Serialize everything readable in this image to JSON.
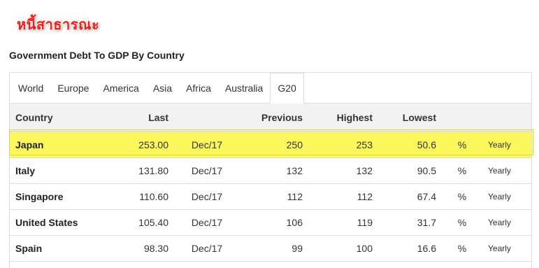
{
  "badge": "หนี้สาธารณะ",
  "title": "Government Debt To GDP By Country",
  "tabs": [
    {
      "label": "World"
    },
    {
      "label": "Europe"
    },
    {
      "label": "America"
    },
    {
      "label": "Asia"
    },
    {
      "label": "Africa"
    },
    {
      "label": "Australia"
    },
    {
      "label": "G20",
      "active": true
    }
  ],
  "table": {
    "headers": {
      "country": "Country",
      "last": "Last",
      "previous": "Previous",
      "highest": "Highest",
      "lowest": "Lowest"
    },
    "rows": [
      {
        "country": "Japan",
        "last": "253.00",
        "date": "Dec/17",
        "previous": "250",
        "highest": "253",
        "lowest": "50.6",
        "unit": "%",
        "frequency": "Yearly",
        "highlighted": true
      },
      {
        "country": "Italy",
        "last": "131.80",
        "date": "Dec/17",
        "previous": "132",
        "highest": "132",
        "lowest": "90.5",
        "unit": "%",
        "frequency": "Yearly"
      },
      {
        "country": "Singapore",
        "last": "110.60",
        "date": "Dec/17",
        "previous": "112",
        "highest": "112",
        "lowest": "67.4",
        "unit": "%",
        "frequency": "Yearly"
      },
      {
        "country": "United States",
        "last": "105.40",
        "date": "Dec/17",
        "previous": "106",
        "highest": "119",
        "lowest": "31.7",
        "unit": "%",
        "frequency": "Yearly"
      },
      {
        "country": "Spain",
        "last": "98.30",
        "date": "Dec/17",
        "previous": "99",
        "highest": "100",
        "lowest": "16.6",
        "unit": "%",
        "frequency": "Yearly"
      }
    ]
  },
  "colors": {
    "highlight": "#fbf75c",
    "badge_text": "#e8211c",
    "header_bg": "#f2f2f2"
  }
}
